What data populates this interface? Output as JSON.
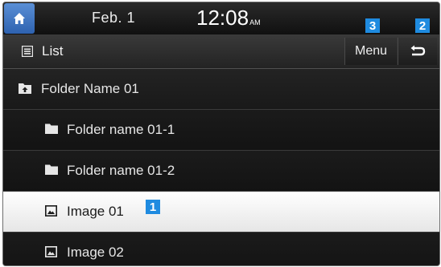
{
  "status": {
    "date": "Feb. 1",
    "time": "12:08",
    "ampm": "AM"
  },
  "header": {
    "title": "List",
    "menu_label": "Menu"
  },
  "callouts": [
    "1",
    "2",
    "3"
  ],
  "list": {
    "items": [
      {
        "label": "Folder Name 01",
        "type": "parent-folder"
      },
      {
        "label": "Folder name 01-1",
        "type": "folder"
      },
      {
        "label": "Folder name 01-2",
        "type": "folder"
      },
      {
        "label": "Image 01",
        "type": "image",
        "selected": true
      },
      {
        "label": "Image 02",
        "type": "image"
      }
    ]
  },
  "colors": {
    "accent": "#1f8be0",
    "home_button": "#3f78c8",
    "selected_row": "#ffffff"
  },
  "icons": [
    "home-icon",
    "list-icon",
    "back-icon",
    "folder-up-icon",
    "folder-icon",
    "image-icon"
  ]
}
